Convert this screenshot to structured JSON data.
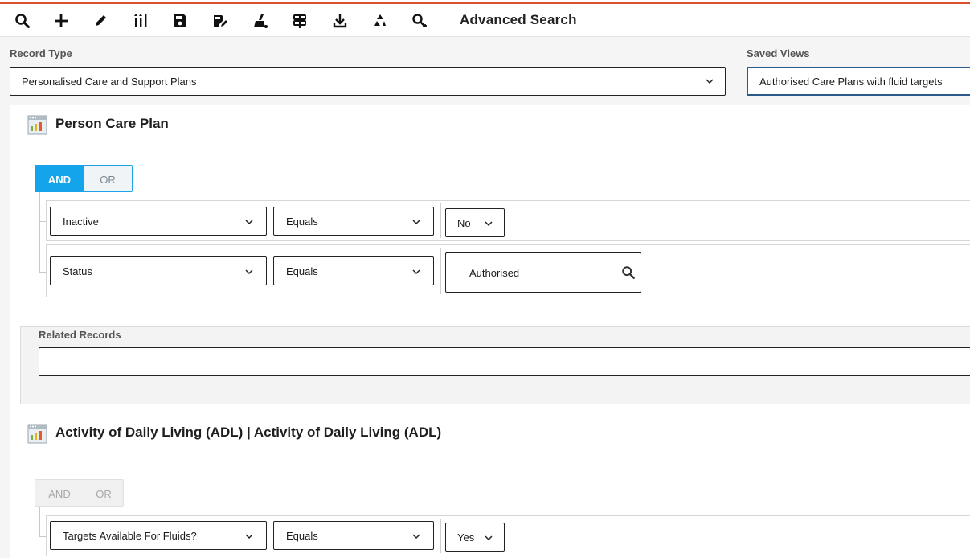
{
  "toolbar": {
    "title": "Advanced Search",
    "icons": [
      "search-icon",
      "add-icon",
      "edit-icon",
      "columns-icon",
      "save-icon",
      "save-as-icon",
      "clear-icon",
      "signpost-icon",
      "download-icon",
      "recycle-icon",
      "key-search-icon"
    ]
  },
  "record_type": {
    "label": "Record Type",
    "value": "Personalised Care and Support Plans"
  },
  "saved_views": {
    "label": "Saved Views",
    "value": "Authorised Care Plans with fluid targets"
  },
  "section1": {
    "title": "Person Care Plan",
    "and_label": "AND",
    "or_label": "OR",
    "rows": [
      {
        "field": "Inactive",
        "operator": "Equals",
        "value": "No"
      },
      {
        "field": "Status",
        "operator": "Equals",
        "value": "Authorised"
      }
    ]
  },
  "related": {
    "label": "Related Records",
    "value": ""
  },
  "section2": {
    "title": "Activity of Daily Living (ADL) | Activity of Daily Living (ADL)",
    "and_label": "AND",
    "or_label": "OR",
    "rows": [
      {
        "field": "Targets Available For Fluids?",
        "operator": "Equals",
        "value": "Yes"
      }
    ]
  },
  "colors": {
    "accent": "#14a4ec",
    "topline": "#d9512c"
  }
}
